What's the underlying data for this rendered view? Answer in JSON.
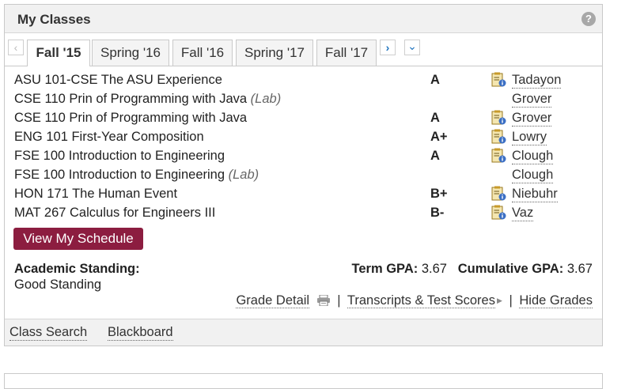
{
  "panel": {
    "title": "My Classes",
    "help_icon": "question-icon"
  },
  "tabs": [
    "Fall '15",
    "Spring '16",
    "Fall '16",
    "Spring '17",
    "Fall '17"
  ],
  "active_tab": 0,
  "nav": {
    "prev": "‹",
    "next": "›",
    "more": "⌄"
  },
  "classes": [
    {
      "course": "ASU 101-CSE The ASU Experience",
      "lab": "",
      "grade": "A",
      "instructor": "Tadayon",
      "icon": true
    },
    {
      "course": "CSE 110 Prin of Programming with Java",
      "lab": "(Lab)",
      "grade": "",
      "instructor": "Grover",
      "icon": false
    },
    {
      "course": "CSE 110 Prin of Programming with Java",
      "lab": "",
      "grade": "A",
      "instructor": "Grover",
      "icon": true
    },
    {
      "course": "ENG 101 First-Year Composition",
      "lab": "",
      "grade": "A+",
      "instructor": "Lowry",
      "icon": true
    },
    {
      "course": "FSE 100 Introduction to Engineering",
      "lab": "",
      "grade": "A",
      "instructor": "Clough",
      "icon": true
    },
    {
      "course": "FSE 100 Introduction to Engineering",
      "lab": "(Lab)",
      "grade": "",
      "instructor": "Clough",
      "icon": false
    },
    {
      "course": "HON 171 The Human Event",
      "lab": "",
      "grade": "B+",
      "instructor": "Niebuhr",
      "icon": true
    },
    {
      "course": "MAT 267 Calculus for Engineers III",
      "lab": "",
      "grade": "B-",
      "instructor": "Vaz",
      "icon": true
    }
  ],
  "schedule_button": "View My Schedule",
  "standing": {
    "label": "Academic Standing:",
    "value": "Good Standing"
  },
  "gpa": {
    "term_label": "Term GPA:",
    "term_value": "3.67",
    "cum_label": "Cumulative GPA:",
    "cum_value": "3.67"
  },
  "links": {
    "grade_detail": "Grade Detail",
    "transcripts": "Transcripts & Test Scores",
    "hide_grades": "Hide Grades",
    "sep": "|"
  },
  "footer": {
    "class_search": "Class Search",
    "blackboard": "Blackboard"
  },
  "colors": {
    "brand": "#8c1d40",
    "link_blue": "#1e73be",
    "icon_gold": "#c79a2a"
  }
}
